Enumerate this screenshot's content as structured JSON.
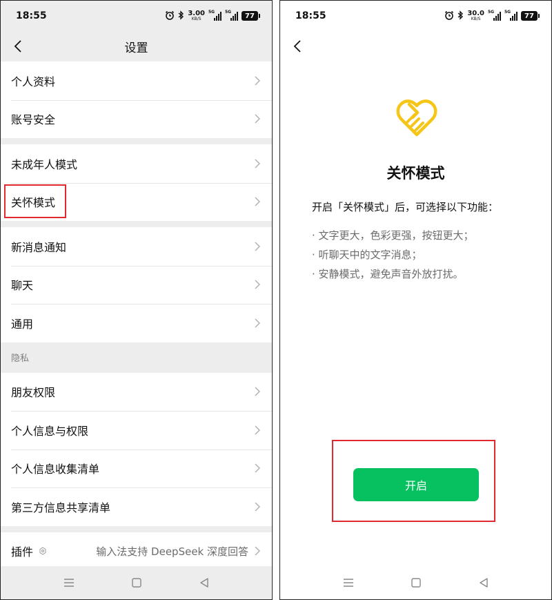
{
  "colors": {
    "accent_green": "#07c160",
    "highlight_red": "#e0282e",
    "care_icon_yellow": "#f5c518",
    "page_gray": "#ededed"
  },
  "left_screen": {
    "status_bar": {
      "time": "18:55",
      "speed_value": "3.00",
      "speed_unit": "KB/S",
      "network_1": "5G",
      "network_2": "5G",
      "battery": "77",
      "icons": [
        "alarm-icon",
        "bluetooth-icon",
        "signal-icon",
        "battery-icon"
      ]
    },
    "nav": {
      "back_icon": "chevron-left-icon",
      "title": "设置"
    },
    "groups": [
      {
        "items": [
          {
            "label": "个人资料"
          },
          {
            "label": "账号安全"
          }
        ]
      },
      {
        "items": [
          {
            "label": "未成年人模式"
          },
          {
            "label": "关怀模式"
          }
        ]
      },
      {
        "items": [
          {
            "label": "新消息通知"
          },
          {
            "label": "聊天"
          },
          {
            "label": "通用"
          }
        ]
      },
      {
        "header": "隐私",
        "items": [
          {
            "label": "朋友权限"
          },
          {
            "label": "个人信息与权限"
          },
          {
            "label": "个人信息收集清单"
          },
          {
            "label": "第三方信息共享清单"
          }
        ]
      },
      {
        "items": [
          {
            "label": "插件",
            "value": "输入法支持 DeepSeek 深度回答"
          }
        ]
      }
    ],
    "highlighted_item": "关怀模式",
    "bottom_nav": [
      "menu-icon",
      "home-square-icon",
      "back-triangle-icon"
    ]
  },
  "right_screen": {
    "status_bar": {
      "time": "18:55",
      "speed_value": "30.0",
      "speed_unit": "KB/S",
      "network_1": "5G",
      "network_2": "5G",
      "battery": "77"
    },
    "nav": {
      "back_icon": "chevron-left-icon"
    },
    "care_mode": {
      "icon": "care-mode-heart-hand-icon",
      "title": "关怀模式",
      "intro": "开启「关怀模式」后，可选择以下功能：",
      "features": [
        "· 文字更大，色彩更强，按钮更大；",
        "· 听聊天中的文字消息；",
        "· 安静模式，避免声音外放打扰。"
      ],
      "button_label": "开启"
    },
    "bottom_nav": [
      "menu-icon",
      "home-square-icon",
      "back-triangle-icon"
    ]
  }
}
